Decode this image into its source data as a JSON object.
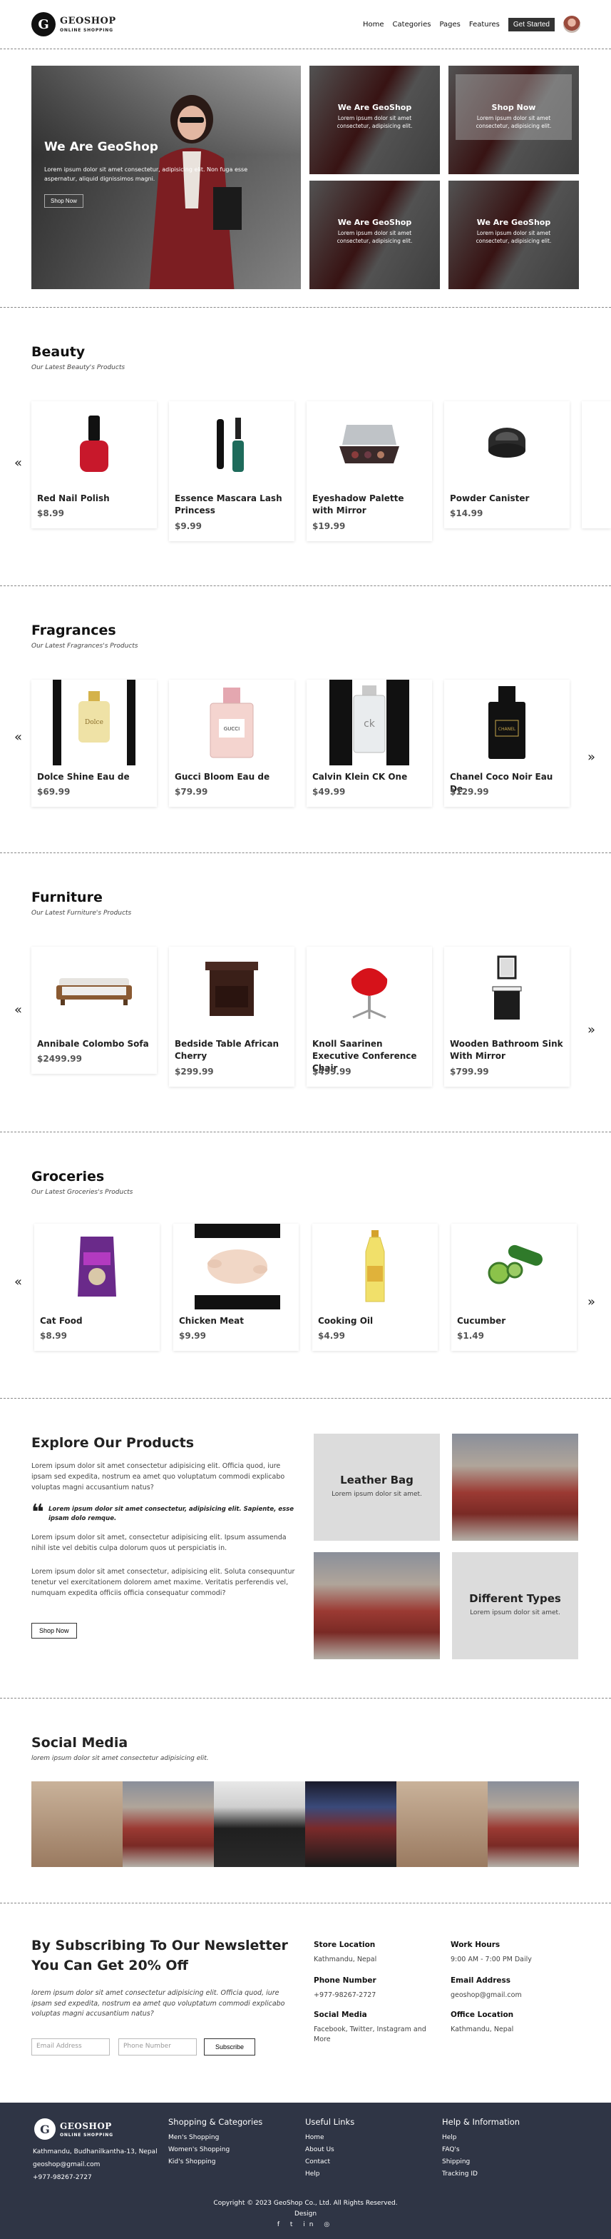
{
  "brand": {
    "name": "GEOSHOP",
    "tagline": "ONLINE SHOPPING",
    "initial": "G"
  },
  "nav": {
    "items": [
      "Home",
      "Categories",
      "Pages",
      "Features"
    ],
    "cta": "Get Started"
  },
  "hero": {
    "main": {
      "title": "We Are GeoShop",
      "text": "Lorem ipsum dolor sit amet consectetur, adipisicing elit. Non fuga esse aspernatur, aliquid dignissimos magni.",
      "button": "Shop Now"
    },
    "cards": [
      {
        "title": "We Are GeoShop",
        "text": "Lorem ipsum dolor sit amet consectetur, adipisicing elit."
      },
      {
        "title": "Shop Now",
        "text": "Lorem ipsum dolor sit amet consectetur, adipisicing elit."
      },
      {
        "title": "We Are GeoShop",
        "text": "Lorem ipsum dolor sit amet consectetur, adipisicing elit."
      },
      {
        "title": "We Are GeoShop",
        "text": "Lorem ipsum dolor sit amet consectetur, adipisicing elit."
      }
    ]
  },
  "arrows": {
    "prev": "«",
    "next": "»"
  },
  "sections": [
    {
      "title": "Beauty",
      "subtitle": "Our Latest Beauty's Products",
      "products": [
        {
          "name": "Red Nail Polish",
          "price": "$8.99"
        },
        {
          "name": "Essence Mascara Lash Princess",
          "price": "$9.99"
        },
        {
          "name": "Eyeshadow Palette with Mirror",
          "price": "$19.99"
        },
        {
          "name": "Powder Canister",
          "price": "$14.99"
        }
      ]
    },
    {
      "title": "Fragrances",
      "subtitle": "Our Latest Fragrances's Products",
      "products": [
        {
          "name": "Dolce Shine Eau de",
          "price": "$69.99"
        },
        {
          "name": "Gucci Bloom Eau de",
          "price": "$79.99"
        },
        {
          "name": "Calvin Klein CK One",
          "price": "$49.99"
        },
        {
          "name": "Chanel Coco Noir Eau De",
          "price": "$129.99"
        }
      ]
    },
    {
      "title": "Furniture",
      "subtitle": "Our Latest Furniture's Products",
      "products": [
        {
          "name": "Annibale Colombo Sofa",
          "price": "$2499.99"
        },
        {
          "name": "Bedside Table African Cherry",
          "price": "$299.99"
        },
        {
          "name": "Knoll Saarinen Executive Conference Chair",
          "price": "$499.99"
        },
        {
          "name": "Wooden Bathroom Sink With Mirror",
          "price": "$799.99"
        }
      ]
    },
    {
      "title": "Groceries",
      "subtitle": "Our Latest Groceries's Products",
      "products": [
        {
          "name": "Cat Food",
          "price": "$8.99"
        },
        {
          "name": "Chicken Meat",
          "price": "$9.99"
        },
        {
          "name": "Cooking Oil",
          "price": "$4.99"
        },
        {
          "name": "Cucumber",
          "price": "$1.49"
        }
      ]
    }
  ],
  "explore": {
    "title": "Explore Our Products",
    "p1": "Lorem ipsum dolor sit amet consectetur adipisicing elit. Officia quod, iure ipsam sed expedita, nostrum ea amet quo voluptatum commodi explicabo voluptas magni accusantium natus?",
    "quote": "Lorem ipsum dolor sit amet consectetur, adipisicing elit. Sapiente, esse ipsam dolo remque.",
    "p2": "Lorem ipsum dolor sit amet, consectetur adipisicing elit. Ipsum assumenda nihil iste vel debitis culpa dolorum quos ut perspiciatis in.",
    "p3": "Lorem ipsum dolor sit amet consectetur, adipisicing elit. Soluta consequuntur tenetur vel exercitationem dolorem amet maxime. Veritatis perferendis vel, numquam expedita officiis officia consequatur commodi?",
    "button": "Shop Now",
    "tiles": [
      {
        "title": "Leather Bag",
        "text": "Lorem ipsum dolor sit amet."
      },
      {
        "title": "Different Types",
        "text": "Lorem ipsum dolor sit amet."
      }
    ]
  },
  "social": {
    "title": "Social Media",
    "subtitle": "lorem ipsum dolor sit amet consectetur adipisicing elit."
  },
  "newsletter": {
    "title": "By Subscribing To Our Newsletter You Can Get 20% Off",
    "text": "lorem ipsum dolor sit amet consectetur adipisicing elit. Officia quod, iure ipsam sed expedita, nostrum ea amet quo voluptatum commodi explicabo voluptas magni accusantium natus?",
    "email_placeholder": "Email Address",
    "phone_placeholder": "Phone Number",
    "button": "Subscribe"
  },
  "info": {
    "store_location": {
      "label": "Store Location",
      "value": "Kathmandu, Nepal"
    },
    "work_hours": {
      "label": "Work Hours",
      "value": "9:00 AM - 7:00 PM Daily"
    },
    "phone": {
      "label": "Phone Number",
      "value": "+977-98267-2727"
    },
    "email": {
      "label": "Email Address",
      "value": "geoshop@gmail.com"
    },
    "social": {
      "label": "Social Media",
      "value": "Facebook, Twitter, Instagram and More"
    },
    "office": {
      "label": "Office Location",
      "value": "Kathmandu, Nepal"
    }
  },
  "footer": {
    "address": "Kathmandu, Budhanilkantha-13, Nepal",
    "email": "geoshop@gmail.com",
    "phone": "+977-98267-2727",
    "col1": {
      "title": "Shopping & Categories",
      "links": [
        "Men's Shopping",
        "Women's Shopping",
        "Kid's Shopping"
      ]
    },
    "col2": {
      "title": "Useful Links",
      "links": [
        "Home",
        "About Us",
        "Contact",
        "Help"
      ]
    },
    "col3": {
      "title": "Help & Information",
      "links": [
        "Help",
        "FAQ's",
        "Shipping",
        "Tracking ID"
      ]
    },
    "copyright": "Copyright © 2023 GeoShop Co., Ltd. All Rights Reserved.",
    "design": "Design",
    "social_icons": "f t in ◎"
  }
}
